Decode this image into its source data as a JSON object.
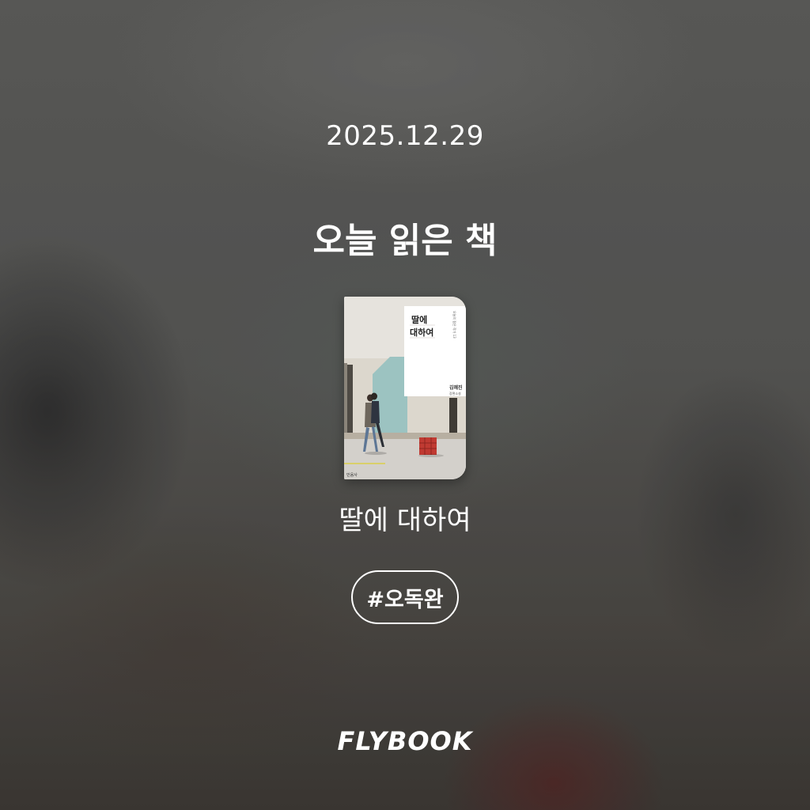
{
  "date": "2025.12.29",
  "heading": "오늘 읽은 책",
  "book": {
    "cover": {
      "title_line1": "딸에",
      "title_line2": "대하여",
      "series": "오늘의 젊은 작가 13",
      "author": "김혜진",
      "genre": "장편소설",
      "publisher": "민음사",
      "icon": "book-cover-image"
    },
    "title": "딸에 대하여"
  },
  "hashtag": "#오독완",
  "brand": "FLYBOOK"
}
